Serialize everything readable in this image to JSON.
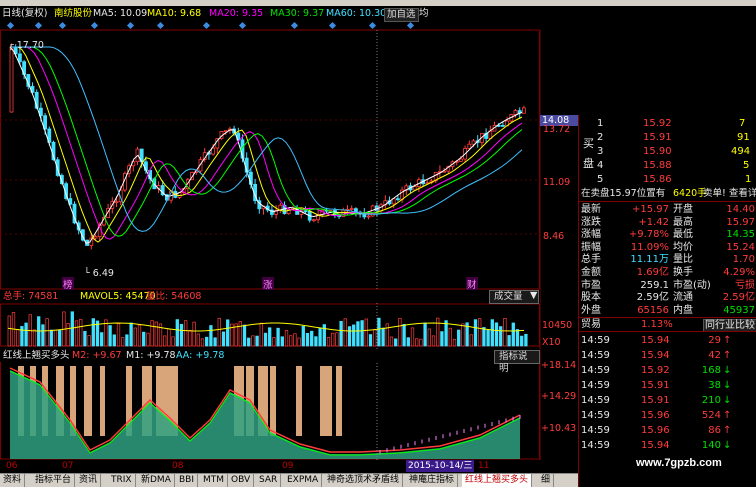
{
  "ma_bar": {
    "title": "日线(复权)",
    "stock_name": "南纺股份",
    "ma5": "MA5: 10.09",
    "ma10": "MA10: 9.68",
    "ma20": "MA20: 9.35",
    "ma30": "MA30: 9.37",
    "ma60": "MA60: 10.30",
    "add_watch_label": "加自选",
    "extra": "均"
  },
  "price_axis": {
    "labels": [
      "14.08",
      "13.72",
      "11.09",
      "8.46"
    ],
    "high_mark": "17.70",
    "low_mark": "6.49"
  },
  "markers": {
    "m1": "榜",
    "m2": "涨",
    "m3": "财"
  },
  "volume_panel": {
    "header_total": "总手: 74581",
    "header_mavol": "MAVOL5: 45470",
    "header_ratio": "量比: 54608",
    "button": "成交量",
    "axis_label": "10450",
    "unit": "X10"
  },
  "indicator_panel": {
    "name": "红线上翘买多头",
    "m2": "M2: +9.67",
    "m1": "M1: +9.78",
    "aa": "AA: +9.78",
    "button": "指标说明",
    "axis": [
      "+18.14",
      "+14.29",
      "+10.43"
    ]
  },
  "x_axis": {
    "months": [
      "06",
      "07",
      "08",
      "09",
      "11"
    ],
    "cursor_date": "2015-10-14/三"
  },
  "tabs": [
    "资料",
    "指标平台",
    "资讯",
    "TRIX",
    "新DMA",
    "BBI",
    "MTM",
    "OBV",
    "SAR",
    "EXPMA",
    "神奇选顶术矛盾线",
    "神庵庄指标",
    "红线上翘买多头",
    "细"
  ],
  "active_tab_index": 12,
  "order_book": {
    "top_price": "14.08",
    "second_price": "13.72",
    "side_label_1": "买",
    "side_label_2": "盘",
    "sell_levels": [
      {
        "level": "1",
        "price": "15.92",
        "vol": "7"
      },
      {
        "level": "2",
        "price": "15.91",
        "vol": "91"
      },
      {
        "level": "3",
        "price": "15.90",
        "vol": "494"
      },
      {
        "level": "4",
        "price": "15.88",
        "vol": "5"
      },
      {
        "level": "5",
        "price": "15.86",
        "vol": "1"
      }
    ],
    "sell_info": "在卖盘15.97位置有",
    "sell_info_vol": "6420手",
    "sell_info_tail": "卖单! 查看详细"
  },
  "quote": {
    "rows": [
      {
        "l1": "最新",
        "v1": "+15.97",
        "l2": "开盘",
        "v2": "14.40"
      },
      {
        "l1": "涨跌",
        "v1": "+1.42",
        "l2": "最高",
        "v2": "15.97"
      },
      {
        "l1": "涨幅",
        "v1": "+9.78%",
        "l2": "最低",
        "v2": "14.35"
      },
      {
        "l1": "振幅",
        "v1": "11.09%",
        "l2": "均价",
        "v2": "15.24"
      },
      {
        "l1": "总手",
        "v1": "11.11万",
        "l2": "量比",
        "v2": "1.70"
      },
      {
        "l1": "金额",
        "v1": "1.69亿",
        "l2": "换手",
        "v2": "4.29%"
      },
      {
        "l1": "市盈",
        "v1": "259.1",
        "l2": "市盈(动)",
        "v2": "亏损"
      },
      {
        "l1": "股本",
        "v1": "2.59亿",
        "l2": "流通",
        "v2": "2.59亿"
      },
      {
        "l1": "外盘",
        "v1": "65156",
        "l2": "内盘",
        "v2": "45937"
      }
    ]
  },
  "industry": {
    "name": "贸易",
    "pct": "1.13%",
    "compare": "同行业比较"
  },
  "ticks": [
    {
      "time": "14:59",
      "price": "15.94",
      "vol": "29",
      "dir": "up"
    },
    {
      "time": "14:59",
      "price": "15.94",
      "vol": "42",
      "dir": "up"
    },
    {
      "time": "14:59",
      "price": "15.92",
      "vol": "168",
      "dir": "down"
    },
    {
      "time": "14:59",
      "price": "15.91",
      "vol": "38",
      "dir": "down"
    },
    {
      "time": "14:59",
      "price": "15.91",
      "vol": "210",
      "dir": "down"
    },
    {
      "time": "14:59",
      "price": "15.96",
      "vol": "524",
      "dir": "up"
    },
    {
      "time": "14:59",
      "price": "15.96",
      "vol": "86",
      "dir": "up"
    },
    {
      "time": "14:59",
      "price": "15.94",
      "vol": "140",
      "dir": "down"
    }
  ],
  "watermark": "www.7gpzb.com",
  "colors": {
    "up": "#ff3c3c",
    "down": "#00e000",
    "ma5": "#ffffff",
    "ma10": "#ffff00",
    "ma20": "#ff00ff",
    "ma30": "#00ff00",
    "ma60": "#40c0ff"
  }
}
